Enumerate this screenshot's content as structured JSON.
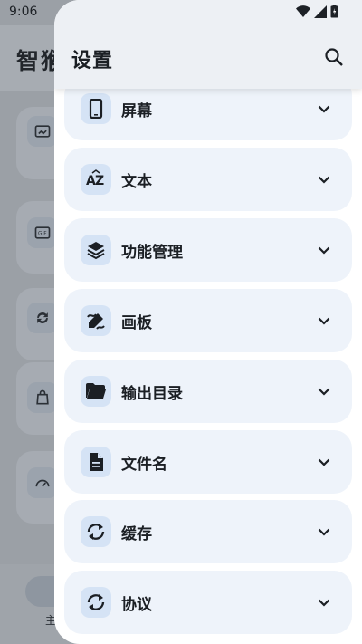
{
  "status_bar": {
    "time": "9:06"
  },
  "background_screen": {
    "title": "智猴",
    "bottom_nav_label": "主"
  },
  "drawer": {
    "title": "设置",
    "items": [
      {
        "label": "屏幕",
        "icon": "phone-icon"
      },
      {
        "label": "文本",
        "icon": "text-az-icon"
      },
      {
        "label": "功能管理",
        "icon": "layers-icon"
      },
      {
        "label": "画板",
        "icon": "draw-icon"
      },
      {
        "label": "输出目录",
        "icon": "folder-open-icon"
      },
      {
        "label": "文件名",
        "icon": "file-icon"
      },
      {
        "label": "缓存",
        "icon": "sync-icon"
      },
      {
        "label": "协议",
        "icon": "sync-icon"
      }
    ]
  },
  "colors": {
    "card_bg": "#eef3fa",
    "icon_bg": "#d5e3f5",
    "header_bg": "#edf0f4",
    "scrim": "#9ba0a6"
  }
}
